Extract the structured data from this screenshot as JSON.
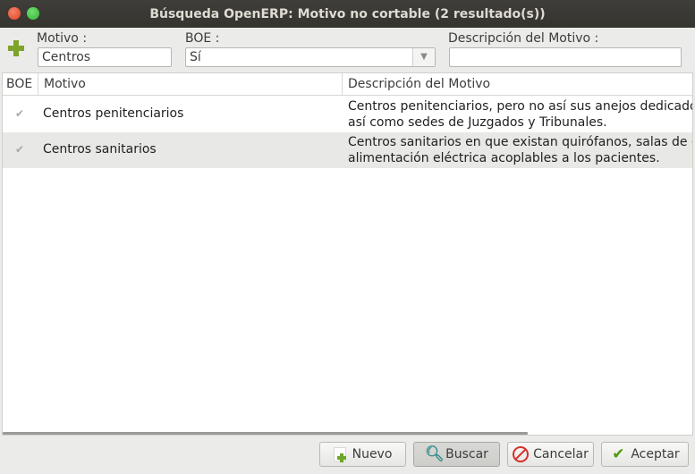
{
  "window": {
    "title": "Búsqueda OpenERP: Motivo no cortable (2 resultado(s))"
  },
  "form": {
    "motivo_label": "Motivo :",
    "motivo_value": "Centros",
    "boe_label": "BOE :",
    "boe_value": "Sí",
    "descripcion_label": "Descripción del Motivo :",
    "descripcion_value": ""
  },
  "table": {
    "headers": {
      "boe": "BOE",
      "motivo": "Motivo",
      "descripcion": "Descripción del Motivo"
    },
    "rows": [
      {
        "boe": true,
        "motivo": "Centros penitenciarios",
        "descripcion_line1": "Centros penitenciarios, pero no así sus anejos dedicados",
        "descripcion_line2": "así como sedes de Juzgados y Tribunales."
      },
      {
        "boe": true,
        "motivo": "Centros sanitarios",
        "descripcion_line1": "Centros sanitarios en que existan quirófanos, salas de cu",
        "descripcion_line2": "alimentación eléctrica acoplables a los pacientes."
      }
    ]
  },
  "buttons": {
    "nuevo": "Nuevo",
    "buscar": "Buscar",
    "cancelar": "Cancelar",
    "aceptar": "Aceptar"
  },
  "colors": {
    "accent_green": "#7ea32b",
    "cancel_red": "#d4312b",
    "titlebar": "#3a3935"
  }
}
